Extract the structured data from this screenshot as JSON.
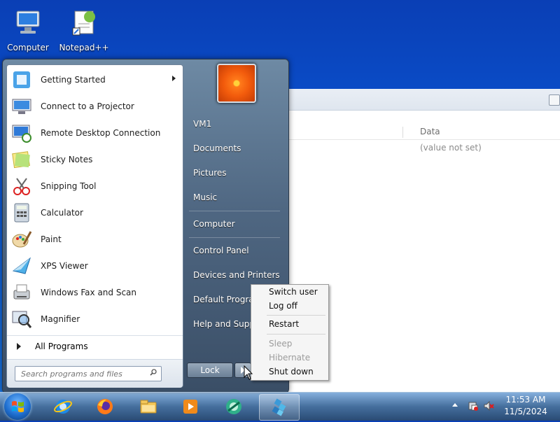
{
  "desktop": {
    "icons": [
      {
        "label": "Computer",
        "icon": "computer-icon"
      },
      {
        "label": "Notepad++",
        "icon": "notepadpp-icon"
      }
    ]
  },
  "background_window": {
    "column_header": "Data",
    "value": "(value not set)",
    "button": "close-button"
  },
  "start_menu": {
    "programs": [
      {
        "label": "Getting Started",
        "icon": "getting-started-icon",
        "has_submenu": true
      },
      {
        "label": "Connect to a Projector",
        "icon": "projector-icon"
      },
      {
        "label": "Remote Desktop Connection",
        "icon": "remote-desktop-icon"
      },
      {
        "label": "Sticky Notes",
        "icon": "sticky-notes-icon"
      },
      {
        "label": "Snipping Tool",
        "icon": "snipping-tool-icon"
      },
      {
        "label": "Calculator",
        "icon": "calculator-icon"
      },
      {
        "label": "Paint",
        "icon": "paint-icon"
      },
      {
        "label": "XPS Viewer",
        "icon": "xps-viewer-icon"
      },
      {
        "label": "Windows Fax and Scan",
        "icon": "fax-scan-icon"
      },
      {
        "label": "Magnifier",
        "icon": "magnifier-icon"
      }
    ],
    "all_programs": "All Programs",
    "search_placeholder": "Search programs and files",
    "right_items": [
      {
        "label": "VM1"
      },
      {
        "label": "Documents"
      },
      {
        "label": "Pictures"
      },
      {
        "label": "Music"
      },
      {
        "label": "Computer"
      },
      {
        "label": "Control Panel"
      },
      {
        "label": "Devices and Printers"
      },
      {
        "label": "Default Programs"
      },
      {
        "label": "Help and Support"
      }
    ],
    "lock_label": "Lock"
  },
  "power_menu": {
    "items": [
      {
        "label": "Switch user",
        "enabled": true
      },
      {
        "label": "Log off",
        "enabled": true
      },
      {
        "label": "Restart",
        "enabled": true
      },
      {
        "label": "Sleep",
        "enabled": false
      },
      {
        "label": "Hibernate",
        "enabled": false
      },
      {
        "label": "Shut down",
        "enabled": true
      }
    ]
  },
  "taskbar": {
    "pinned": [
      "internet-explorer-icon",
      "firefox-icon",
      "file-explorer-icon",
      "media-player-icon",
      "disk-cleanup-icon",
      "registry-editor-icon"
    ],
    "time": "11:53 AM",
    "date": "11/5/2024"
  },
  "colors": {
    "desktop": "#0a55d4",
    "menu_right": "#4f6782"
  }
}
